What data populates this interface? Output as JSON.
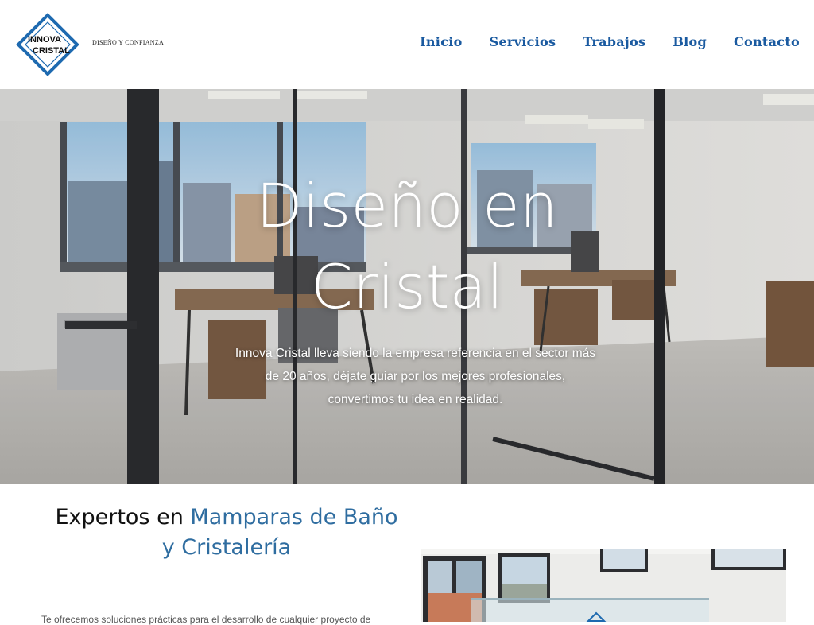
{
  "header": {
    "logo": {
      "line1": "INNOVA",
      "line2": "CRISTAL"
    },
    "tagline": "DISEÑO Y CONFIANZA",
    "nav": [
      {
        "label": "Inicio"
      },
      {
        "label": "Servicios"
      },
      {
        "label": "Trabajos"
      },
      {
        "label": "Blog"
      },
      {
        "label": "Contacto"
      }
    ]
  },
  "hero": {
    "title_line1": "Diseño en",
    "title_line2": "Cristal",
    "text_line1": "Innova Cristal lleva siendo la empresa referencia en el sector más",
    "text_line2": "de 20 años, déjate guiar por los mejores profesionales,",
    "text_line3": "convertimos tu idea en realidad."
  },
  "section": {
    "headline_plain": "Expertos en",
    "headline_accent_1": "Mamparas de Baño",
    "headline_accent_2": "y Cristalería",
    "body_partial": "Te ofrecemos soluciones prácticas para el desarrollo de cualquier proyecto de"
  },
  "colors": {
    "nav": "#1a5aa0",
    "accent": "#2f6da0",
    "logo": "#1e6ab0"
  },
  "icons": {
    "logo": "innova-cristal-logo-icon"
  }
}
